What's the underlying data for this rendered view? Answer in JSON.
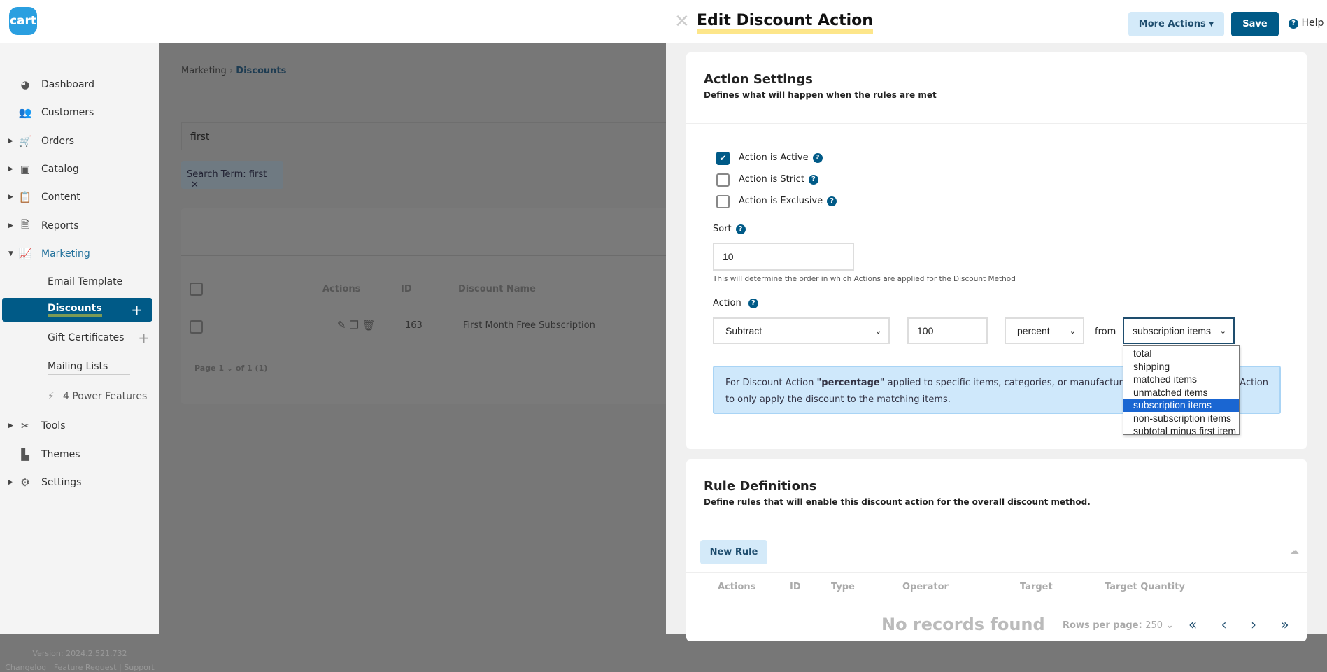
{
  "logo": "cart",
  "sidebar": {
    "items": [
      {
        "label": "Dashboard",
        "icon": "dashboard-icon",
        "glyph": "◕",
        "caret": false
      },
      {
        "label": "Customers",
        "icon": "customers-icon",
        "glyph": "👥",
        "caret": false
      },
      {
        "label": "Orders",
        "icon": "cart-icon",
        "glyph": "🛒",
        "caret": true
      },
      {
        "label": "Catalog",
        "icon": "catalog-icon",
        "glyph": "▣",
        "caret": true
      },
      {
        "label": "Content",
        "icon": "clipboard-icon",
        "glyph": "📋",
        "caret": true
      },
      {
        "label": "Reports",
        "icon": "report-icon",
        "glyph": "🗎",
        "caret": true
      },
      {
        "label": "Marketing",
        "icon": "marketing-chart-icon",
        "glyph": "📈",
        "caret": true
      }
    ],
    "sub": [
      "Email Template",
      "Discounts",
      "Gift Certificates",
      "Mailing Lists"
    ],
    "power": "4 Power Features",
    "bottom": [
      {
        "label": "Tools",
        "glyph": "✂",
        "caret": true
      },
      {
        "label": "Themes",
        "glyph": "▙",
        "caret": false
      },
      {
        "label": "Settings",
        "glyph": "⚙",
        "caret": true
      }
    ],
    "version": "Version: 2024.2.521.732",
    "links": "Changelog | Feature Request | Support"
  },
  "main": {
    "breadcrumb": [
      "Marketing",
      "Discounts"
    ],
    "search": "first",
    "chip": "Search Term: first",
    "columns": [
      "Actions",
      "ID",
      "Discount Name"
    ],
    "row": {
      "id": "163",
      "name": "First Month Free Subscription"
    },
    "pager": "Page 1 ⌄ of 1 (1)"
  },
  "panel": {
    "title": "Edit Discount Action",
    "more_actions": "More Actions",
    "save": "Save",
    "help": "Help",
    "settings": {
      "title": "Action Settings",
      "subtitle": "Defines what will happen when the rules are met",
      "checks": [
        {
          "label": "Action is Active",
          "checked": true
        },
        {
          "label": "Action is Strict",
          "checked": false
        },
        {
          "label": "Action is Exclusive",
          "checked": false
        }
      ],
      "sort_label": "Sort",
      "sort_value": "10",
      "sort_help": "This will determine the order in which Actions are applied for the Discount Method",
      "action_label": "Action",
      "operation": "Subtract",
      "amount": "100",
      "unit": "percent",
      "from": "from",
      "target": "subscription items",
      "options": [
        "total",
        "shipping",
        "matched items",
        "unmatched items",
        "subscription items",
        "non-subscription items",
        "subtotal minus first item"
      ],
      "info_pre": "For Discount Action ",
      "info_bold": "\"percentage\"",
      "info_post": " applied to specific items, categories, or manufacturers, sel",
      "info_end": "Action",
      "info_line2": "to only apply the discount to the matching items."
    },
    "rules": {
      "title": "Rule Definitions",
      "subtitle": "Define rules that will enable this discount action for the overall discount method.",
      "new_rule": "New Rule",
      "columns": [
        "Actions",
        "ID",
        "Type",
        "Operator",
        "Target",
        "Target Quantity"
      ],
      "empty": "No records found",
      "rows_per_page_label": "Rows per page:",
      "rows_per_page": "250"
    }
  },
  "colors": {
    "primary": "#005a87",
    "light_button": "#d4eaf9",
    "highlight": "#1a66d2"
  }
}
